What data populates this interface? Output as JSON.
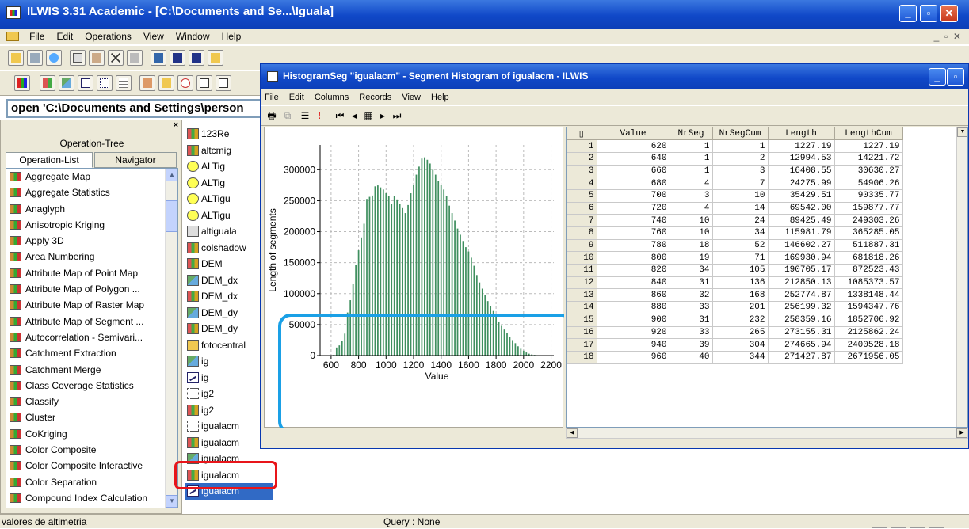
{
  "main_window": {
    "title": "ILWIS 3.31 Academic - [C:\\Documents and Se...\\Iguala]",
    "menu": [
      "File",
      "Edit",
      "Operations",
      "View",
      "Window",
      "Help"
    ],
    "command_line": "open 'C:\\Documents and Settings\\person"
  },
  "left_pane": {
    "operation_tree_tab": "Operation-Tree",
    "tabs": [
      "Operation-List",
      "Navigator"
    ],
    "operations": [
      "Aggregate Map",
      "Aggregate Statistics",
      "Anaglyph",
      "Anisotropic Kriging",
      "Apply 3D",
      "Area Numbering",
      "Attribute Map of Point Map",
      "Attribute Map of Polygon ...",
      "Attribute Map of Raster Map",
      "Attribute Map of Segment ...",
      "Autocorrelation - Semivari...",
      "Catchment Extraction",
      "Catchment Merge",
      "Class Coverage Statistics",
      "Classify",
      "Cluster",
      "CoKriging",
      "Color Composite",
      "Color Composite Interactive",
      "Color Separation",
      "Compound Index Calculation"
    ]
  },
  "catalog": {
    "items": [
      {
        "name": "123Re",
        "icon": "raster-map-icon"
      },
      {
        "name": "altcmig",
        "icon": "raster-map-icon"
      },
      {
        "name": "ALTig",
        "icon": "point-map-icon"
      },
      {
        "name": "ALTig",
        "icon": "point-map-icon"
      },
      {
        "name": "ALTigu",
        "icon": "point-map-icon"
      },
      {
        "name": "ALTigu",
        "icon": "point-map-icon"
      },
      {
        "name": "altiguala",
        "icon": "map-view-icon"
      },
      {
        "name": "colshadow",
        "icon": "raster-map-icon"
      },
      {
        "name": "DEM",
        "icon": "raster-map-icon"
      },
      {
        "name": "DEM_dx",
        "icon": "polygon-map-icon"
      },
      {
        "name": "DEM_dx",
        "icon": "raster-map-icon"
      },
      {
        "name": "DEM_dy",
        "icon": "polygon-map-icon"
      },
      {
        "name": "DEM_dy",
        "icon": "raster-map-icon"
      },
      {
        "name": "fotocentral",
        "icon": "folder-icon"
      },
      {
        "name": "ig",
        "icon": "polygon-map-icon"
      },
      {
        "name": "ig",
        "icon": "segment-map-icon"
      },
      {
        "name": "ig2",
        "icon": "domain-icon"
      },
      {
        "name": "ig2",
        "icon": "raster-map-icon"
      },
      {
        "name": "igualacm",
        "icon": "domain-icon"
      },
      {
        "name": "igualacm",
        "icon": "raster-map-icon"
      },
      {
        "name": "igualacm",
        "icon": "polygon-map-icon"
      },
      {
        "name": "igualacm",
        "icon": "raster-map-icon"
      },
      {
        "name": "igualacm",
        "icon": "segment-map-icon"
      }
    ],
    "selected_index": 22
  },
  "histogram_window": {
    "title": "HistogramSeg \"igualacm\" - Segment Histogram of igualacm - ILWIS",
    "menu": [
      "File",
      "Edit",
      "Columns",
      "Records",
      "View",
      "Help"
    ],
    "columns": [
      "Value",
      "NrSeg",
      "NrSegCum",
      "Length",
      "LengthCum"
    ],
    "rows": [
      [
        "1",
        "620",
        "1",
        "1",
        "1227.19",
        "1227.19"
      ],
      [
        "2",
        "640",
        "1",
        "2",
        "12994.53",
        "14221.72"
      ],
      [
        "3",
        "660",
        "1",
        "3",
        "16408.55",
        "30630.27"
      ],
      [
        "4",
        "680",
        "4",
        "7",
        "24275.99",
        "54906.26"
      ],
      [
        "5",
        "700",
        "3",
        "10",
        "35429.51",
        "90335.77"
      ],
      [
        "6",
        "720",
        "4",
        "14",
        "69542.00",
        "159877.77"
      ],
      [
        "7",
        "740",
        "10",
        "24",
        "89425.49",
        "249303.26"
      ],
      [
        "8",
        "760",
        "10",
        "34",
        "115981.79",
        "365285.05"
      ],
      [
        "9",
        "780",
        "18",
        "52",
        "146602.27",
        "511887.31"
      ],
      [
        "10",
        "800",
        "19",
        "71",
        "169930.94",
        "681818.26"
      ],
      [
        "11",
        "820",
        "34",
        "105",
        "190705.17",
        "872523.43"
      ],
      [
        "12",
        "840",
        "31",
        "136",
        "212850.13",
        "1085373.57"
      ],
      [
        "13",
        "860",
        "32",
        "168",
        "252774.87",
        "1338148.44"
      ],
      [
        "14",
        "880",
        "33",
        "201",
        "256199.32",
        "1594347.76"
      ],
      [
        "15",
        "900",
        "31",
        "232",
        "258359.16",
        "1852706.92"
      ],
      [
        "16",
        "920",
        "33",
        "265",
        "273155.31",
        "2125862.24"
      ],
      [
        "17",
        "940",
        "39",
        "304",
        "274665.94",
        "2400528.18"
      ],
      [
        "18",
        "960",
        "40",
        "344",
        "271427.87",
        "2671956.05"
      ]
    ]
  },
  "chart_data": {
    "type": "bar",
    "xlabel": "Value",
    "ylabel": "Length of segments",
    "xlim": [
      520,
      2220
    ],
    "ylim": [
      0,
      340000
    ],
    "xticks": [
      600,
      800,
      1000,
      1200,
      1400,
      1600,
      1800,
      2000,
      2200
    ],
    "yticks": [
      0,
      50000,
      100000,
      150000,
      200000,
      250000,
      300000
    ],
    "bar_width": 20,
    "x": [
      620,
      640,
      660,
      680,
      700,
      720,
      740,
      760,
      780,
      800,
      820,
      840,
      860,
      880,
      900,
      920,
      940,
      960,
      980,
      1000,
      1020,
      1040,
      1060,
      1080,
      1100,
      1120,
      1140,
      1160,
      1180,
      1200,
      1220,
      1240,
      1260,
      1280,
      1300,
      1320,
      1340,
      1360,
      1380,
      1400,
      1420,
      1440,
      1460,
      1480,
      1500,
      1520,
      1540,
      1560,
      1580,
      1600,
      1620,
      1640,
      1660,
      1680,
      1700,
      1720,
      1740,
      1760,
      1780,
      1800,
      1820,
      1840,
      1860,
      1880,
      1900,
      1920,
      1940,
      1960,
      1980,
      2000,
      2020,
      2040,
      2060,
      2080,
      2100
    ],
    "values": [
      1227,
      12995,
      16409,
      24276,
      35430,
      69542,
      89425,
      115982,
      146602,
      169931,
      190705,
      212850,
      252775,
      256199,
      258359,
      273155,
      274666,
      271428,
      268000,
      262000,
      258000,
      245000,
      258000,
      252000,
      245000,
      238000,
      230000,
      243000,
      262000,
      275000,
      292000,
      305000,
      318000,
      320000,
      316000,
      310000,
      300000,
      292000,
      282000,
      275000,
      268000,
      258000,
      242000,
      230000,
      218000,
      205000,
      195000,
      185000,
      175000,
      168000,
      158000,
      145000,
      130000,
      118000,
      108000,
      98000,
      88000,
      80000,
      72000,
      64000,
      55000,
      48000,
      42000,
      36000,
      30000,
      25000,
      20000,
      15000,
      11000,
      8000,
      5000,
      3000,
      2000,
      1000,
      500
    ]
  },
  "status_bar": {
    "left": "valores de altimetria",
    "middle": "Query : None"
  },
  "colors": {
    "bar": "#3f8f5f",
    "highlight_blue": "#1aa0e6",
    "highlight_red": "#e8151a"
  }
}
